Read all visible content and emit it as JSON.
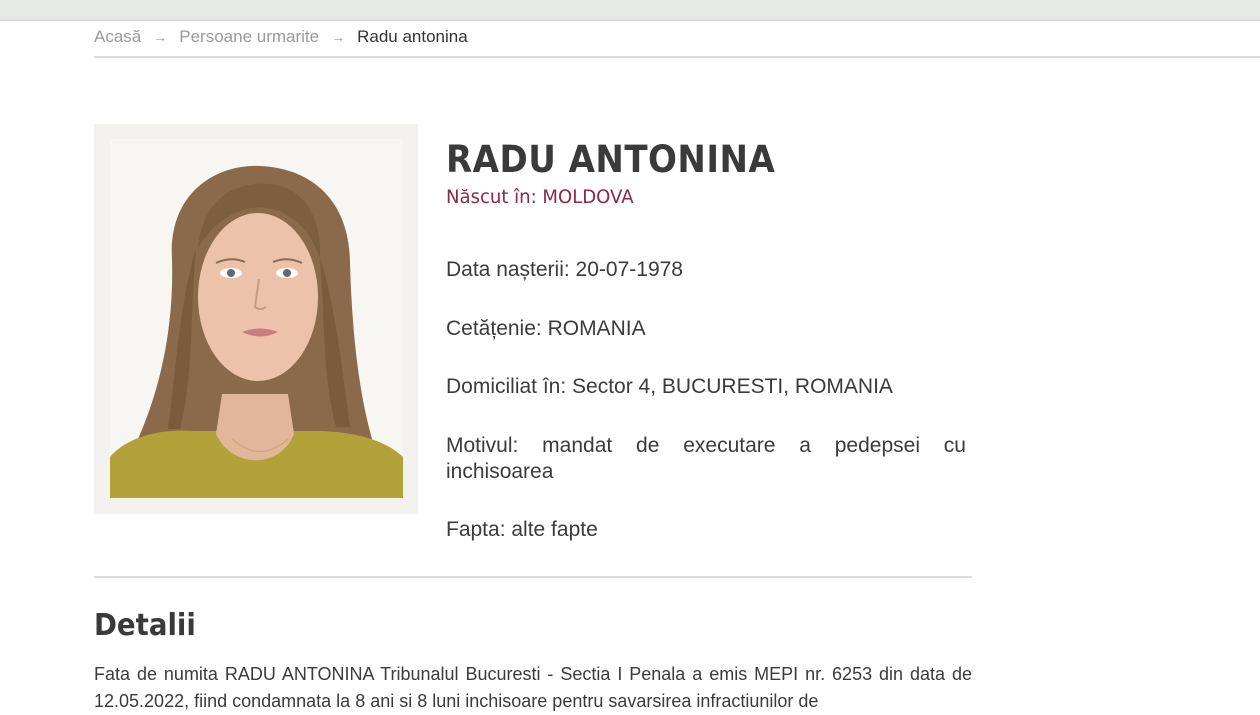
{
  "breadcrumb": {
    "home": "Acasă",
    "section": "Persoane urmarite",
    "current": "Radu antonina",
    "separator": "→"
  },
  "person": {
    "name": "RADU ANTONINA",
    "born": "Născut în: MOLDOVA",
    "birth_date": "Data nașterii: 20-07-1978",
    "citizenship": "Cetățenie: ROMANIA",
    "domicile": "Domiciliat în: Sector 4, BUCURESTI, ROMANIA",
    "reason": "Motivul: mandat de executare a pedepsei cu inchisoarea",
    "deed": "Fapta: alte fapte",
    "photo_icon": "person-photo"
  },
  "details": {
    "title": "Detalii",
    "text": "Fata de numita RADU ANTONINA Tribunalul Bucuresti - Sectia I Penala a emis MEPI nr. 6253 din data de 12.05.2022, fiind condamnata la 8 ani si 8 luni inchisoare pentru savarsirea infractiunilor de"
  },
  "colors": {
    "accent": "#8b2846",
    "text": "#3b3b3b",
    "muted": "#9a9a9a",
    "frame": "#f3f2ee"
  }
}
